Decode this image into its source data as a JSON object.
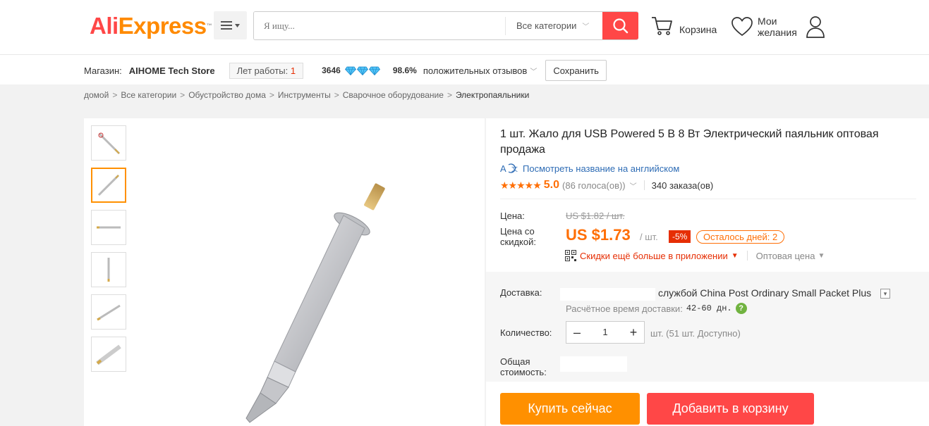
{
  "header": {
    "logo_part1": "Ali",
    "logo_part2": "Express",
    "logo_tm": "™",
    "search_placeholder": "Я ищу...",
    "category_select": "Все категории",
    "cart_label": "Корзина",
    "wishlist_line1": "Мои",
    "wishlist_line2": "желания"
  },
  "store": {
    "label": "Магазин:",
    "name": "AIHOME Tech Store",
    "years_label": "Лет работы:",
    "years_value": "1",
    "rank": "3646",
    "positive_pct": "98.6%",
    "positive_text": "положительных отзывов",
    "save_button": "Сохранить"
  },
  "breadcrumb": {
    "items": [
      "домой",
      "Все категории",
      "Обустройство дома",
      "Инструменты",
      "Сварочное оборудование"
    ],
    "current": "Электропаяльники"
  },
  "product": {
    "title": "1 шт. Жало для USB Powered 5 В 8 Вт Электрический паяльник оптовая продажа",
    "translate_link": "Посмотреть название на английском",
    "stars": "★★★★★",
    "rating": "5.0",
    "votes": "(86 голоса(ов))",
    "orders": "340 заказа(ов)",
    "price_label": "Цена:",
    "old_price": "US $1.82 / шт.",
    "discount_price_label": "Цена со скидкой:",
    "new_price": "US $1.73",
    "unit": "/ шт.",
    "discount_pct": "-5%",
    "days_left": "Осталось дней: 2",
    "app_promo": "Скидки ещё больше в приложении",
    "wholesale": "Оптовая цена"
  },
  "shipping": {
    "label": "Доставка:",
    "method": "службой China Post Ordinary Small Packet Plus",
    "eta_label": "Расчётное время доставки:",
    "eta_value": "42-60 дн.",
    "quantity_label": "Количество:",
    "quantity": "1",
    "stock": "шт. (51 шт. Доступно)",
    "total_label": "Общая стоимость:"
  },
  "actions": {
    "buy_now": "Купить сейчас",
    "add_to_cart": "Добавить в корзину"
  },
  "colors": {
    "brand_red": "#ff4747",
    "brand_orange": "#ff9000",
    "price_orange": "#ff6f06",
    "link_blue": "#2e6cb5"
  }
}
